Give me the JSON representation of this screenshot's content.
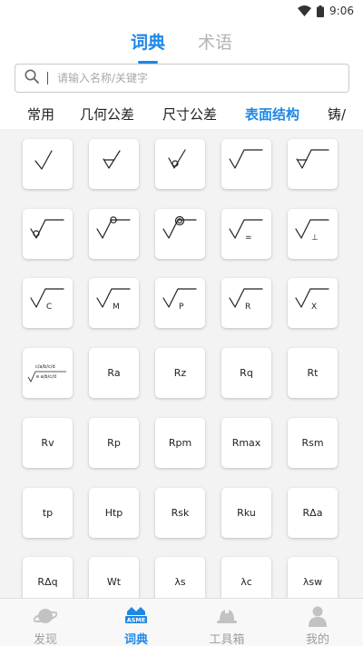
{
  "status_bar": {
    "time": "9:06"
  },
  "header": {
    "tabs": [
      {
        "label": "词典",
        "active": true
      },
      {
        "label": "术语",
        "active": false
      }
    ]
  },
  "search": {
    "placeholder": "请输入名称/关键字",
    "value": ""
  },
  "categories": [
    {
      "label": "常用",
      "active": false
    },
    {
      "label": "几何公差",
      "active": false
    },
    {
      "label": "尺寸公差",
      "active": false
    },
    {
      "label": "表面结构",
      "active": true
    },
    {
      "label": "铸/",
      "active": false
    }
  ],
  "symbol_rows": [
    [
      {
        "type": "icon",
        "icon": "surface-basic-icon"
      },
      {
        "type": "icon",
        "icon": "surface-removal-triangle-icon"
      },
      {
        "type": "icon",
        "icon": "surface-no-removal-circle-icon"
      },
      {
        "type": "icon",
        "icon": "surface-extended-icon"
      },
      {
        "type": "icon",
        "icon": "surface-extended-triangle-icon"
      }
    ],
    [
      {
        "type": "icon",
        "icon": "surface-extended-circle-icon"
      },
      {
        "type": "icon",
        "icon": "surface-all-around-icon"
      },
      {
        "type": "icon",
        "icon": "surface-all-around-double-icon"
      },
      {
        "type": "icon",
        "icon": "lay-parallel-icon",
        "letter": "="
      },
      {
        "type": "icon",
        "icon": "lay-perpendicular-icon",
        "letter": "⊥"
      }
    ],
    [
      {
        "type": "icon",
        "icon": "lay-c-icon",
        "letter": "C"
      },
      {
        "type": "icon",
        "icon": "lay-m-icon",
        "letter": "M"
      },
      {
        "type": "icon",
        "icon": "lay-p-icon",
        "letter": "P"
      },
      {
        "type": "icon",
        "icon": "lay-r-icon",
        "letter": "R"
      },
      {
        "type": "icon",
        "icon": "lay-x-icon",
        "letter": "X"
      }
    ],
    [
      {
        "type": "icon",
        "icon": "surface-annotation-template-icon",
        "top_text": "c/a/b/c/d",
        "bottom_text": "e a/b/c/d"
      },
      {
        "type": "text",
        "label": "Ra"
      },
      {
        "type": "text",
        "label": "Rz"
      },
      {
        "type": "text",
        "label": "Rq"
      },
      {
        "type": "text",
        "label": "Rt"
      }
    ],
    [
      {
        "type": "text",
        "label": "Rv"
      },
      {
        "type": "text",
        "label": "Rp"
      },
      {
        "type": "text",
        "label": "Rpm"
      },
      {
        "type": "text",
        "label": "Rmax"
      },
      {
        "type": "text",
        "label": "Rsm"
      }
    ],
    [
      {
        "type": "text",
        "label": "tp"
      },
      {
        "type": "text",
        "label": "Htp"
      },
      {
        "type": "text",
        "label": "Rsk"
      },
      {
        "type": "text",
        "label": "Rku"
      },
      {
        "type": "text",
        "label": "RΔa"
      }
    ],
    [
      {
        "type": "text",
        "label": "RΔq"
      },
      {
        "type": "text",
        "label": "Wt"
      },
      {
        "type": "text",
        "label": "λs"
      },
      {
        "type": "text",
        "label": "λc"
      },
      {
        "type": "text",
        "label": "λsw"
      }
    ]
  ],
  "bottom_nav": [
    {
      "label": "发现",
      "icon": "planet-icon",
      "active": false
    },
    {
      "label": "词典",
      "icon": "asme-icon",
      "active": true,
      "badge_text": "ASME"
    },
    {
      "label": "工具箱",
      "icon": "hardhat-icon",
      "active": false
    },
    {
      "label": "我的",
      "icon": "user-icon",
      "active": false
    }
  ],
  "colors": {
    "accent": "#1e88e5",
    "inactive": "#b4b4b4",
    "grid_bg": "#f3f3f3"
  }
}
